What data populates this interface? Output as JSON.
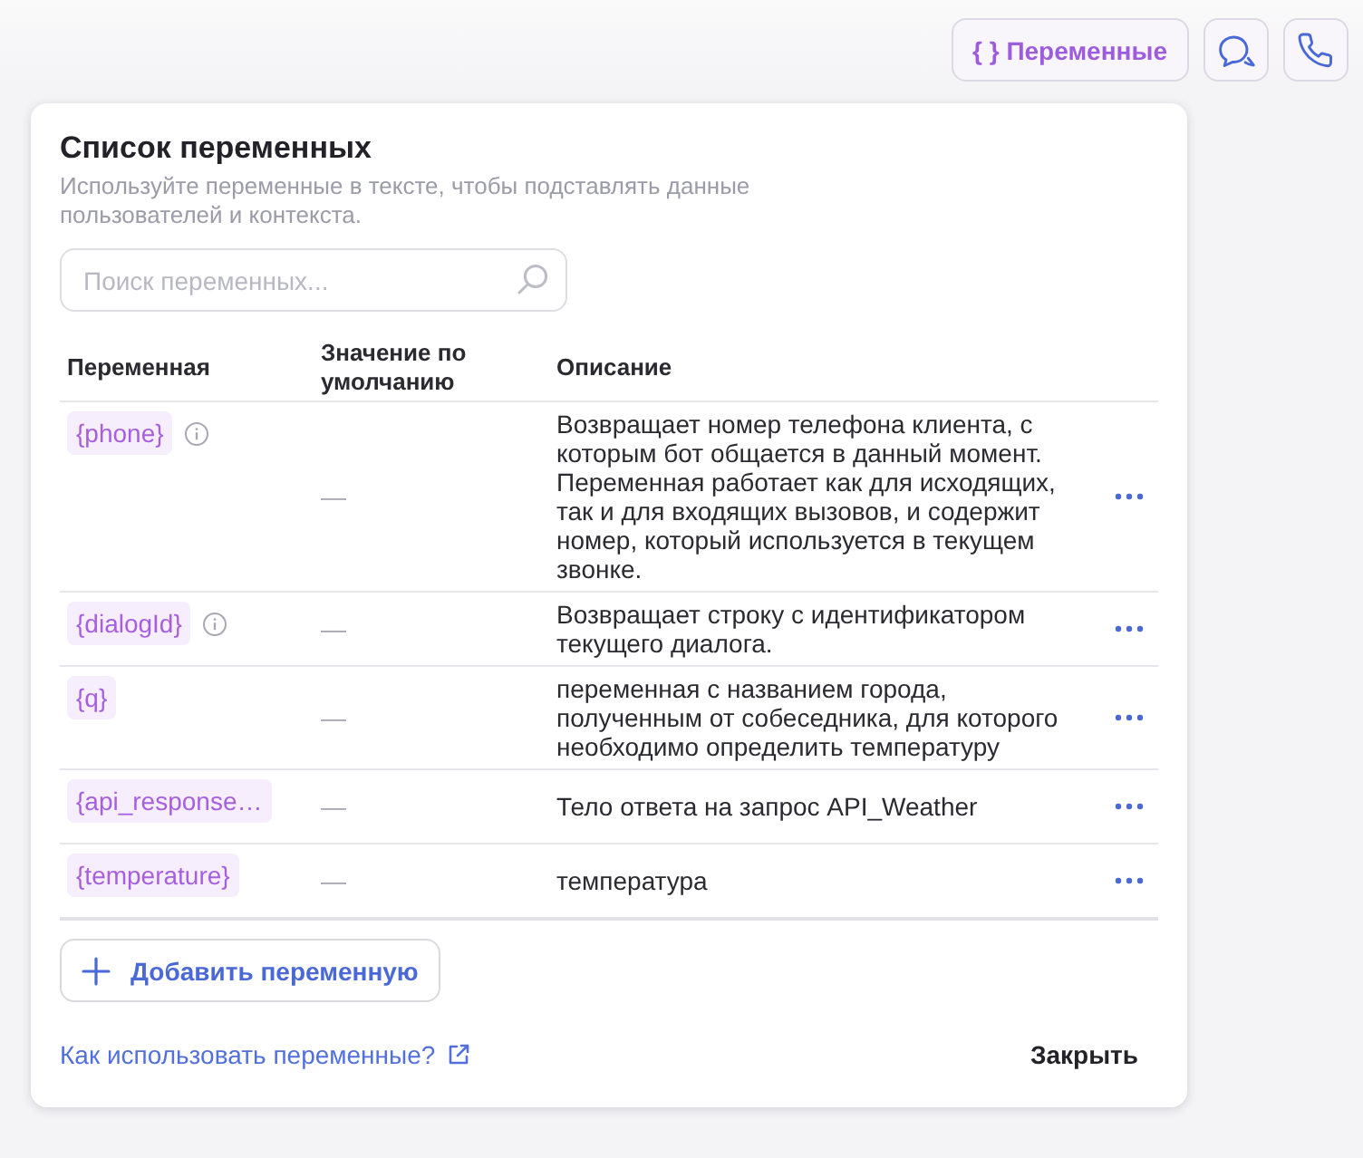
{
  "toolbar": {
    "variables_button": "{ } Переменные"
  },
  "panel": {
    "title": "Список переменных",
    "subtitle": "Используйте переменные в тексте, чтобы подставлять данные пользователей и контекста.",
    "search": {
      "placeholder": "Поиск переменных..."
    },
    "table": {
      "columns": [
        "Переменная",
        "Значение по умолчанию",
        "Описание"
      ],
      "rows": [
        {
          "name": "{phone}",
          "has_info": true,
          "default": "—",
          "description": "Возвращает номер телефона клиента, с которым бот общается в данный момент. Переменная работает как для исходящих, так и для входящих вызовов, и содержит номер, который используется в текущем звонке."
        },
        {
          "name": "{dialogId}",
          "has_info": true,
          "default": "—",
          "description": "Возвращает строку с идентификатором текущего диалога."
        },
        {
          "name": "{q}",
          "has_info": false,
          "default": "—",
          "description": "переменная с названием города, полученным от собеседника, для которого необходимо определить температуру"
        },
        {
          "name": "{api_response…",
          "has_info": false,
          "default": "—",
          "description": "Тело ответа на запрос API_Weather"
        },
        {
          "name": "{temperature}",
          "has_info": false,
          "default": "—",
          "description": "температура"
        }
      ]
    },
    "add_button": "Добавить переменную",
    "help_link": "Как использовать переменные?",
    "close_button": "Закрыть"
  }
}
